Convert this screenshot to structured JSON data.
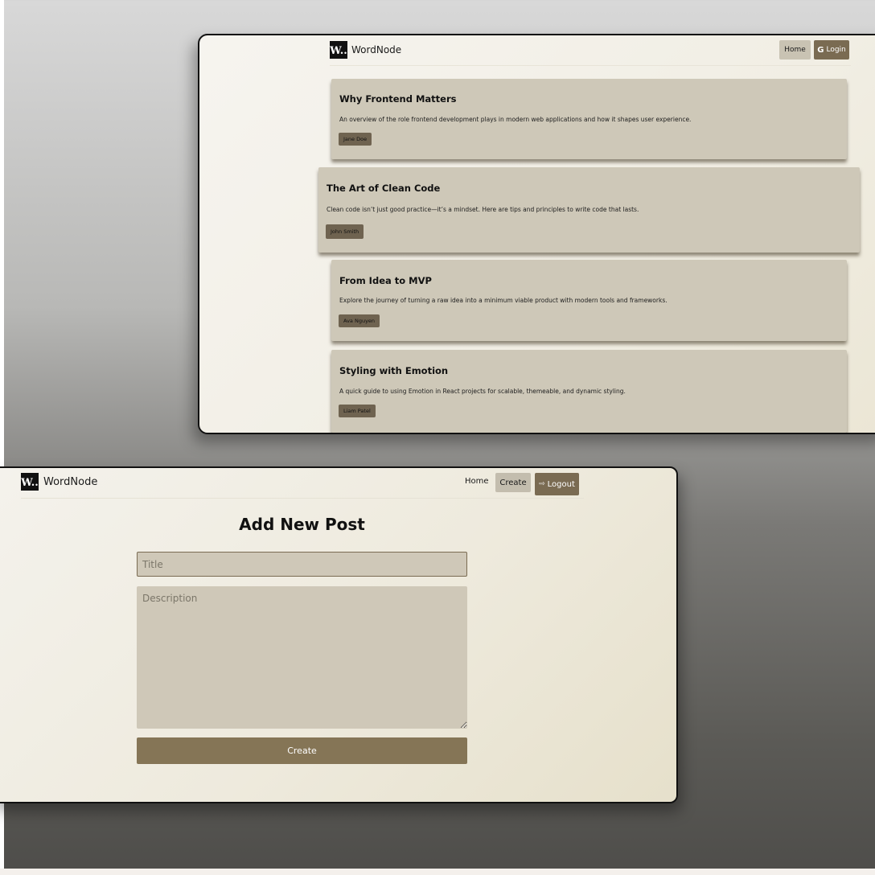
{
  "feed_window": {
    "brand": {
      "logo_text": "W..",
      "name": "WordNode"
    },
    "nav": {
      "home_label": "Home",
      "login_icon": "G",
      "login_label": "Login"
    },
    "posts": [
      {
        "title": "Why Frontend Matters",
        "description": "An overview of the role frontend development plays in modern web applications and how it shapes user experience.",
        "author": "Jane Doe"
      },
      {
        "title": "The Art of Clean Code",
        "description": "Clean code isn’t just good practice—it’s a mindset. Here are tips and principles to write code that lasts.",
        "author": "John Smith"
      },
      {
        "title": "From Idea to MVP",
        "description": "Explore the journey of turning a raw idea into a minimum viable product with modern tools and frameworks.",
        "author": "Ava Nguyen"
      },
      {
        "title": "Styling with Emotion",
        "description": "A quick guide to using Emotion in React projects for scalable, themeable, and dynamic styling.",
        "author": "Liam Patel"
      }
    ]
  },
  "create_window": {
    "brand": {
      "logo_text": "W..",
      "name": "WordNode"
    },
    "nav": {
      "home_label": "Home",
      "create_label": "Create",
      "logout_icon": "logout-icon",
      "logout_label": "Logout"
    },
    "form": {
      "heading": "Add New Post",
      "title_placeholder": "Title",
      "title_value": "",
      "description_placeholder": "Description",
      "description_value": "",
      "submit_label": "Create"
    }
  },
  "colors": {
    "card_bg": "#cec8b8",
    "accent": "#7a6b52",
    "submit": "#857556",
    "window_bg": "#f3f0e8"
  }
}
